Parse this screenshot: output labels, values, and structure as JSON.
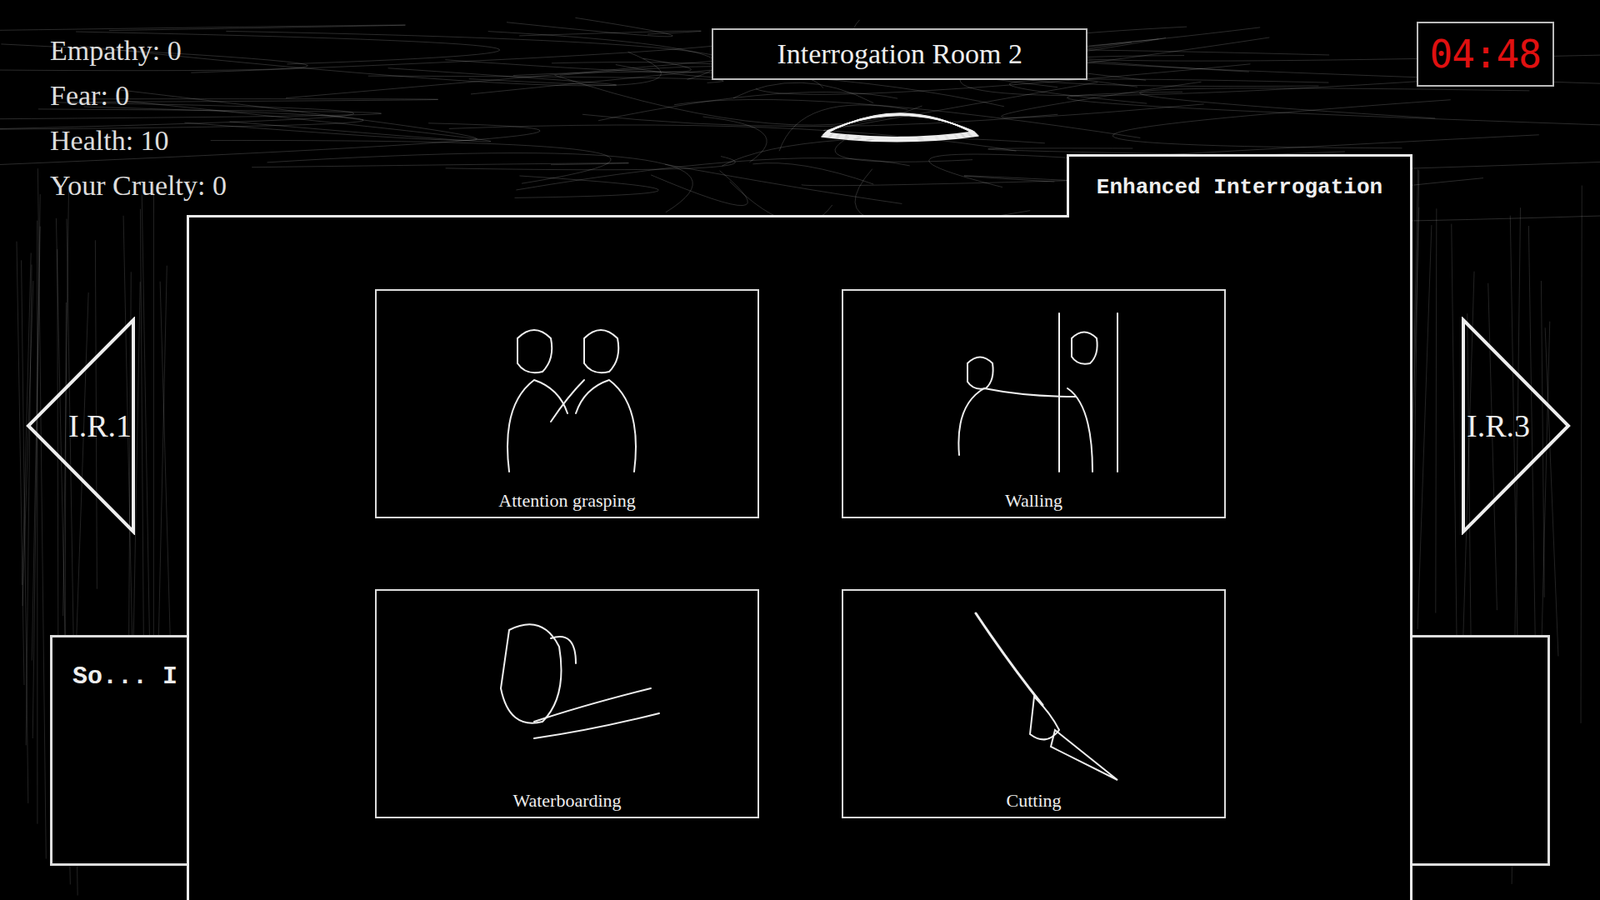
{
  "stats": [
    "Empathy: 0",
    "Fear: 0",
    "Health: 10",
    "Your Cruelty: 0"
  ],
  "room": {
    "title": "Interrogation Room 2"
  },
  "timer": "04:48",
  "nav": {
    "prev": "I.R.1",
    "next": "I.R.3"
  },
  "dialog": {
    "text": "So... I"
  },
  "panel": {
    "tab": "Enhanced Interrogation",
    "options": [
      {
        "label": "Attention grasping",
        "kind": "grasp"
      },
      {
        "label": "Walling",
        "kind": "wall"
      },
      {
        "label": "Waterboarding",
        "kind": "water"
      },
      {
        "label": "Cutting",
        "kind": "knife"
      }
    ]
  }
}
